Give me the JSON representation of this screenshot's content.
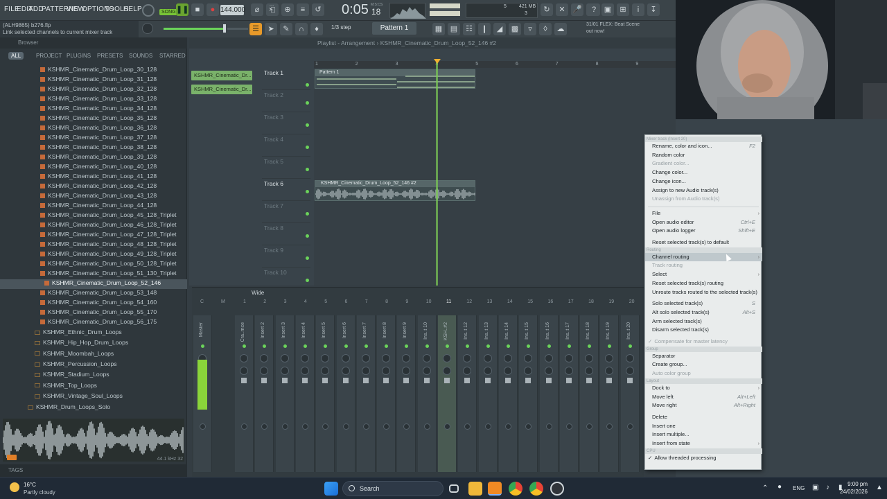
{
  "menu": [
    "FILE",
    "EDIT",
    "ADD",
    "PATTERNS",
    "VIEW",
    "OPTIONS",
    "TOOLS",
    "HELP"
  ],
  "transport": {
    "mode": "SONG",
    "tempo": "144.000",
    "time": "0:05",
    "time_small": "18",
    "time_label": "M:S:CS",
    "memory": "421 MB",
    "cpu": "5",
    "voices": "3"
  },
  "hint": {
    "file": "(ALH9865) b276.flp",
    "text": "Link selected channels to current mixer track"
  },
  "toolbar2": {
    "snap": "1/3 step",
    "pattern": "Pattern 1",
    "flex_line1": "31/01  FLEX: Beat Scene",
    "flex_line2": "out now!"
  },
  "browser": {
    "title": "Browser",
    "tabs": [
      "ALL",
      "PROJECT",
      "PLUGINS",
      "PRESETS",
      "SOUNDS",
      "STARRED"
    ],
    "files": [
      "KSHMR_Cinematic_Drum_Loop_30_128",
      "KSHMR_Cinematic_Drum_Loop_31_128",
      "KSHMR_Cinematic_Drum_Loop_32_128",
      "KSHMR_Cinematic_Drum_Loop_33_128",
      "KSHMR_Cinematic_Drum_Loop_34_128",
      "KSHMR_Cinematic_Drum_Loop_35_128",
      "KSHMR_Cinematic_Drum_Loop_36_128",
      "KSHMR_Cinematic_Drum_Loop_37_128",
      "KSHMR_Cinematic_Drum_Loop_38_128",
      "KSHMR_Cinematic_Drum_Loop_39_128",
      "KSHMR_Cinematic_Drum_Loop_40_128",
      "KSHMR_Cinematic_Drum_Loop_41_128",
      "KSHMR_Cinematic_Drum_Loop_42_128",
      "KSHMR_Cinematic_Drum_Loop_43_128",
      "KSHMR_Cinematic_Drum_Loop_44_128",
      "KSHMR_Cinematic_Drum_Loop_45_128_Triplet",
      "KSHMR_Cinematic_Drum_Loop_46_128_Triplet",
      "KSHMR_Cinematic_Drum_Loop_47_128_Triplet",
      "KSHMR_Cinematic_Drum_Loop_48_128_Triplet",
      "KSHMR_Cinematic_Drum_Loop_49_128_Triplet",
      "KSHMR_Cinematic_Drum_Loop_50_128_Triplet",
      "KSHMR_Cinematic_Drum_Loop_51_130_Triplet",
      "KSHMR_Cinematic_Drum_Loop_52_146",
      "KSHMR_Cinematic_Drum_Loop_53_148",
      "KSHMR_Cinematic_Drum_Loop_54_160",
      "KSHMR_Cinematic_Drum_Loop_55_170",
      "KSHMR_Cinematic_Drum_Loop_56_175"
    ],
    "selected_index": 22,
    "folders": [
      "KSHMR_Ethnic_Drum_Loops",
      "KSHMR_Hip_Hop_Drum_Loops",
      "KSHMR_Moombah_Loops",
      "KSHMR_Percussion_Loops",
      "KSHMR_Stadium_Loops",
      "KSHMR_Top_Loops",
      "KSHMR_Vintage_Soul_Loops"
    ],
    "parent_folder": "KSHMR_Drum_Loops_Solo",
    "sample_info": "44.1 kHz 32",
    "tags_label": "TAGS"
  },
  "playlist": {
    "title": "Playlist - Arrangement",
    "crumb": "KSHMR_Cinematic_Drum_Loop_52_146 #2",
    "picker": [
      "KSHMR_Cinematic_Dr...",
      "KSHMR_Cinematic_Dr..."
    ],
    "ruler": [
      "1",
      "2",
      "3",
      "4",
      "5",
      "6",
      "7",
      "8",
      "9"
    ],
    "tracks": [
      "Track 1",
      "Track 2",
      "Track 3",
      "Track 4",
      "Track 5",
      "Track 6",
      "Track 7",
      "Track 8",
      "Track 9",
      "Track 10"
    ],
    "pattern_clip": "Pattern 1",
    "audio_clip": "KSHMR_Cinematic_Drum_Loop_52_146 #2"
  },
  "mixer": {
    "preset": "Wide",
    "numbers": [
      "C",
      "M",
      "1",
      "2",
      "3",
      "4",
      "5",
      "6",
      "7",
      "8",
      "9",
      "10",
      "11",
      "12",
      "13",
      "14",
      "15",
      "16",
      "17",
      "18",
      "19",
      "20"
    ],
    "strips": [
      "Master",
      "Cra..mce",
      "Insert 2",
      "Insert 3",
      "Insert 4",
      "Insert 5",
      "Insert 6",
      "Insert 7",
      "Insert 8",
      "Insert 9",
      "Ins..t 10",
      "KSH..#2",
      "Ins..t 12",
      "Ins..t 13",
      "Ins..t 14",
      "Ins..t 15",
      "Ins..t 16",
      "Ins..t 17",
      "Ins..t 18",
      "Ins..t 19",
      "Ins..t 20"
    ]
  },
  "context_menu": {
    "header": "Mixer track (Insert 20)",
    "items": [
      {
        "label": "Rename, color and icon...",
        "shortcut": "F2"
      },
      {
        "label": "Random color"
      },
      {
        "label": "Gradient color...",
        "disabled": true
      },
      {
        "label": "Change color..."
      },
      {
        "label": "Change icon..."
      },
      {
        "label": "Assign to new Audio track(s)"
      },
      {
        "label": "Unassign from Audio track(s)",
        "disabled": true
      }
    ],
    "items2": [
      {
        "label": "File",
        "arrow": true
      },
      {
        "label": "Open audio editor",
        "shortcut": "Ctrl+E"
      },
      {
        "label": "Open audio logger",
        "shortcut": "Shift+E"
      }
    ],
    "reset_default": "Reset selected track(s) to default",
    "routing_header": "Routing",
    "routing": [
      {
        "label": "Channel routing",
        "arrow": true,
        "highlight": true
      },
      {
        "label": "Track routing",
        "disabled": true
      },
      {
        "label": "Select",
        "arrow": true
      },
      {
        "label": "Reset selected track(s) routing"
      },
      {
        "label": "Unroute tracks routed to the selected track(s)"
      }
    ],
    "solo": [
      {
        "label": "Solo selected track(s)",
        "shortcut": "S"
      },
      {
        "label": "Alt solo selected track(s)",
        "shortcut": "Alt+S"
      },
      {
        "label": "Arm selected track(s)"
      },
      {
        "label": "Disarm selected track(s)"
      }
    ],
    "compensate": "Compensate for master latency",
    "group_header": "Group",
    "group": [
      {
        "label": "Separator"
      },
      {
        "label": "Create group..."
      },
      {
        "label": "Auto color group",
        "disabled": true
      }
    ],
    "layout_header": "Layout",
    "layout": [
      {
        "label": "Dock to",
        "arrow": true
      },
      {
        "label": "Move left",
        "shortcut": "Alt+Left"
      },
      {
        "label": "Move right",
        "shortcut": "Alt+Right"
      }
    ],
    "insert": [
      {
        "label": "Delete"
      },
      {
        "label": "Insert one"
      },
      {
        "label": "Insert multiple..."
      },
      {
        "label": "Insert from state",
        "arrow": true
      }
    ],
    "cpu_header": "CPU",
    "threaded": "Allow threaded processing"
  },
  "taskbar": {
    "weather_temp": "16°C",
    "weather_desc": "Partly cloudy",
    "search": "Search",
    "lang": "ENG",
    "time": "9:00 pm",
    "date": "24/02/2026"
  },
  "colors": {
    "accent_green": "#7ccc55",
    "clip_header": "#5b6e6e",
    "menu_bg": "#e9ecec",
    "orange": "#ff9a1a"
  }
}
